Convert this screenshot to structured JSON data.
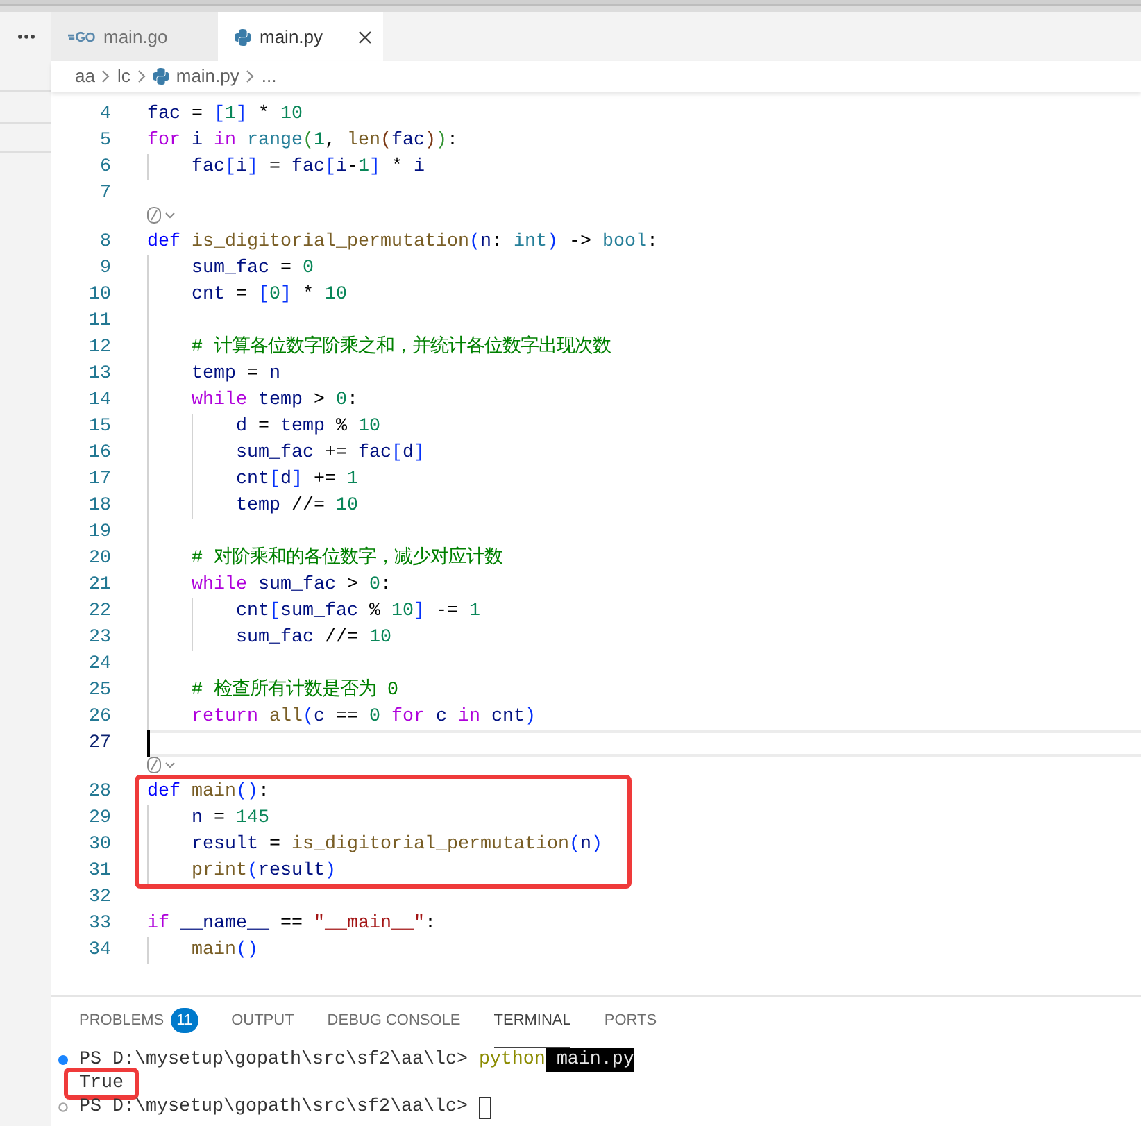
{
  "tabs": [
    {
      "label": "main.go",
      "kind": "go",
      "selected": false
    },
    {
      "label": "main.py",
      "kind": "python",
      "selected": true
    }
  ],
  "breadcrumbs": [
    {
      "label": "aa",
      "kind": "folder"
    },
    {
      "label": "lc",
      "kind": "folder"
    },
    {
      "label": "main.py",
      "kind": "python"
    },
    {
      "label": "...",
      "kind": "symbols"
    }
  ],
  "editor": {
    "lines": [
      {
        "kind": "code",
        "number": "4",
        "current": false,
        "boxed": false,
        "tokens": [
          {
            "text": "fac",
            "kind": "var"
          },
          {
            "text": " = ",
            "kind": "op"
          },
          {
            "text": "[",
            "kind": "b1"
          },
          {
            "text": "1",
            "kind": "num"
          },
          {
            "text": "]",
            "kind": "b1"
          },
          {
            "text": " * ",
            "kind": "op"
          },
          {
            "text": "10",
            "kind": "num"
          }
        ]
      },
      {
        "kind": "code",
        "number": "5",
        "current": false,
        "boxed": false,
        "tokens": [
          {
            "text": "for",
            "kind": "ctl"
          },
          {
            "text": " i",
            "kind": "var"
          },
          {
            "text": " in",
            "kind": "ctl"
          },
          {
            "text": " range",
            "kind": "type"
          },
          {
            "text": "(",
            "kind": "b2"
          },
          {
            "text": "1",
            "kind": "num"
          },
          {
            "text": ", ",
            "kind": "op"
          },
          {
            "text": "len",
            "kind": "fn"
          },
          {
            "text": "(",
            "kind": "b3"
          },
          {
            "text": "fac",
            "kind": "var"
          },
          {
            "text": ")",
            "kind": "b3"
          },
          {
            "text": ")",
            "kind": "b2"
          },
          {
            "text": ":",
            "kind": "op"
          }
        ]
      },
      {
        "kind": "code",
        "number": "6",
        "current": false,
        "boxed": false,
        "tokens": [
          {
            "text": "    fac",
            "kind": "var"
          },
          {
            "text": "[",
            "kind": "b1"
          },
          {
            "text": "i",
            "kind": "var"
          },
          {
            "text": "]",
            "kind": "b1"
          },
          {
            "text": " = ",
            "kind": "op"
          },
          {
            "text": "fac",
            "kind": "var"
          },
          {
            "text": "[",
            "kind": "b1"
          },
          {
            "text": "i",
            "kind": "var"
          },
          {
            "text": "-",
            "kind": "op"
          },
          {
            "text": "1",
            "kind": "num"
          },
          {
            "text": "]",
            "kind": "b1"
          },
          {
            "text": " * ",
            "kind": "op"
          },
          {
            "text": "i",
            "kind": "var"
          }
        ]
      },
      {
        "kind": "code",
        "number": "7",
        "current": false,
        "boxed": false
      },
      {
        "kind": "lens"
      },
      {
        "kind": "code",
        "number": "8",
        "current": false,
        "boxed": false,
        "tokens": [
          {
            "text": "def",
            "kind": "kw"
          },
          {
            "text": " is_digitorial_permutation",
            "kind": "fn"
          },
          {
            "text": "(",
            "kind": "b1"
          },
          {
            "text": "n",
            "kind": "var"
          },
          {
            "text": ": ",
            "kind": "op"
          },
          {
            "text": "int",
            "kind": "type"
          },
          {
            "text": ")",
            "kind": "b1"
          },
          {
            "text": " -> ",
            "kind": "op"
          },
          {
            "text": "bool",
            "kind": "type"
          },
          {
            "text": ":",
            "kind": "op"
          }
        ]
      },
      {
        "kind": "code",
        "number": "9",
        "current": false,
        "boxed": false,
        "tokens": [
          {
            "text": "    sum_fac",
            "kind": "var"
          },
          {
            "text": " = ",
            "kind": "op"
          },
          {
            "text": "0",
            "kind": "num"
          }
        ]
      },
      {
        "kind": "code",
        "number": "10",
        "current": false,
        "boxed": false,
        "tokens": [
          {
            "text": "    cnt",
            "kind": "var"
          },
          {
            "text": " = ",
            "kind": "op"
          },
          {
            "text": "[",
            "kind": "b1"
          },
          {
            "text": "0",
            "kind": "num"
          },
          {
            "text": "]",
            "kind": "b1"
          },
          {
            "text": " * ",
            "kind": "op"
          },
          {
            "text": "10",
            "kind": "num"
          }
        ]
      },
      {
        "kind": "code",
        "number": "11",
        "current": false,
        "boxed": false
      },
      {
        "kind": "code",
        "number": "12",
        "current": false,
        "boxed": false,
        "tokens": [
          {
            "text": "    # 计算各位数字阶乘之和，并统计各位数字出现次数",
            "kind": "com"
          }
        ]
      },
      {
        "kind": "code",
        "number": "13",
        "current": false,
        "boxed": false,
        "tokens": [
          {
            "text": "    temp",
            "kind": "var"
          },
          {
            "text": " = ",
            "kind": "op"
          },
          {
            "text": "n",
            "kind": "var"
          }
        ]
      },
      {
        "kind": "code",
        "number": "14",
        "current": false,
        "boxed": false,
        "tokens": [
          {
            "text": "    while",
            "kind": "ctl"
          },
          {
            "text": " temp",
            "kind": "var"
          },
          {
            "text": " > ",
            "kind": "op"
          },
          {
            "text": "0",
            "kind": "num"
          },
          {
            "text": ":",
            "kind": "op"
          }
        ]
      },
      {
        "kind": "code",
        "number": "15",
        "current": false,
        "boxed": false,
        "tokens": [
          {
            "text": "        d",
            "kind": "var"
          },
          {
            "text": " = ",
            "kind": "op"
          },
          {
            "text": "temp",
            "kind": "var"
          },
          {
            "text": " % ",
            "kind": "op"
          },
          {
            "text": "10",
            "kind": "num"
          }
        ]
      },
      {
        "kind": "code",
        "number": "16",
        "current": false,
        "boxed": false,
        "tokens": [
          {
            "text": "        sum_fac",
            "kind": "var"
          },
          {
            "text": " += ",
            "kind": "op"
          },
          {
            "text": "fac",
            "kind": "var"
          },
          {
            "text": "[",
            "kind": "b1"
          },
          {
            "text": "d",
            "kind": "var"
          },
          {
            "text": "]",
            "kind": "b1"
          }
        ]
      },
      {
        "kind": "code",
        "number": "17",
        "current": false,
        "boxed": false,
        "tokens": [
          {
            "text": "        cnt",
            "kind": "var"
          },
          {
            "text": "[",
            "kind": "b1"
          },
          {
            "text": "d",
            "kind": "var"
          },
          {
            "text": "]",
            "kind": "b1"
          },
          {
            "text": " += ",
            "kind": "op"
          },
          {
            "text": "1",
            "kind": "num"
          }
        ]
      },
      {
        "kind": "code",
        "number": "18",
        "current": false,
        "boxed": false,
        "tokens": [
          {
            "text": "        temp",
            "kind": "var"
          },
          {
            "text": " //= ",
            "kind": "op"
          },
          {
            "text": "10",
            "kind": "num"
          }
        ]
      },
      {
        "kind": "code",
        "number": "19",
        "current": false,
        "boxed": false
      },
      {
        "kind": "code",
        "number": "20",
        "current": false,
        "boxed": false,
        "tokens": [
          {
            "text": "    # 对阶乘和的各位数字，减少对应计数",
            "kind": "com"
          }
        ]
      },
      {
        "kind": "code",
        "number": "21",
        "current": false,
        "boxed": false,
        "tokens": [
          {
            "text": "    while",
            "kind": "ctl"
          },
          {
            "text": " sum_fac",
            "kind": "var"
          },
          {
            "text": " > ",
            "kind": "op"
          },
          {
            "text": "0",
            "kind": "num"
          },
          {
            "text": ":",
            "kind": "op"
          }
        ]
      },
      {
        "kind": "code",
        "number": "22",
        "current": false,
        "boxed": false,
        "tokens": [
          {
            "text": "        cnt",
            "kind": "var"
          },
          {
            "text": "[",
            "kind": "b1"
          },
          {
            "text": "sum_fac",
            "kind": "var"
          },
          {
            "text": " % ",
            "kind": "op"
          },
          {
            "text": "10",
            "kind": "num"
          },
          {
            "text": "]",
            "kind": "b1"
          },
          {
            "text": " -= ",
            "kind": "op"
          },
          {
            "text": "1",
            "kind": "num"
          }
        ]
      },
      {
        "kind": "code",
        "number": "23",
        "current": false,
        "boxed": false,
        "tokens": [
          {
            "text": "        sum_fac",
            "kind": "var"
          },
          {
            "text": " //= ",
            "kind": "op"
          },
          {
            "text": "10",
            "kind": "num"
          }
        ]
      },
      {
        "kind": "code",
        "number": "24",
        "current": false,
        "boxed": false
      },
      {
        "kind": "code",
        "number": "25",
        "current": false,
        "boxed": false,
        "tokens": [
          {
            "text": "    # 检查所有计数是否为 0",
            "kind": "com"
          }
        ]
      },
      {
        "kind": "code",
        "number": "26",
        "current": false,
        "boxed": false,
        "tokens": [
          {
            "text": "    return",
            "kind": "ctl"
          },
          {
            "text": " all",
            "kind": "fn"
          },
          {
            "text": "(",
            "kind": "b1"
          },
          {
            "text": "c",
            "kind": "var"
          },
          {
            "text": " == ",
            "kind": "op"
          },
          {
            "text": "0",
            "kind": "num"
          },
          {
            "text": " for",
            "kind": "ctl"
          },
          {
            "text": " c",
            "kind": "var"
          },
          {
            "text": " in",
            "kind": "ctl"
          },
          {
            "text": " cnt",
            "kind": "var"
          },
          {
            "text": ")",
            "kind": "b1"
          }
        ]
      },
      {
        "kind": "code",
        "number": "27",
        "current": true,
        "boxed": false
      },
      {
        "kind": "lens"
      },
      {
        "kind": "code",
        "number": "28",
        "current": false,
        "boxed": true,
        "tokens": [
          {
            "text": "def",
            "kind": "kw"
          },
          {
            "text": " main",
            "kind": "fn"
          },
          {
            "text": "()",
            "kind": "b1"
          },
          {
            "text": ":",
            "kind": "op"
          }
        ]
      },
      {
        "kind": "code",
        "number": "29",
        "current": false,
        "boxed": true,
        "tokens": [
          {
            "text": "    n",
            "kind": "var"
          },
          {
            "text": " = ",
            "kind": "op"
          },
          {
            "text": "145",
            "kind": "num"
          }
        ]
      },
      {
        "kind": "code",
        "number": "30",
        "current": false,
        "boxed": true,
        "tokens": [
          {
            "text": "    result",
            "kind": "var"
          },
          {
            "text": " = ",
            "kind": "op"
          },
          {
            "text": "is_digitorial_permutation",
            "kind": "fn"
          },
          {
            "text": "(",
            "kind": "b1"
          },
          {
            "text": "n",
            "kind": "var"
          },
          {
            "text": ")",
            "kind": "b1"
          }
        ]
      },
      {
        "kind": "code",
        "number": "31",
        "current": false,
        "boxed": true,
        "tokens": [
          {
            "text": "    print",
            "kind": "fn"
          },
          {
            "text": "(",
            "kind": "b1"
          },
          {
            "text": "result",
            "kind": "var"
          },
          {
            "text": ")",
            "kind": "b1"
          }
        ]
      },
      {
        "kind": "code",
        "number": "32",
        "current": false,
        "boxed": false
      },
      {
        "kind": "code",
        "number": "33",
        "current": false,
        "boxed": false,
        "tokens": [
          {
            "text": "if",
            "kind": "ctl"
          },
          {
            "text": " __name__",
            "kind": "var"
          },
          {
            "text": " == ",
            "kind": "op"
          },
          {
            "text": "\"__main__\"",
            "kind": "str"
          },
          {
            "text": ":",
            "kind": "op"
          }
        ]
      },
      {
        "kind": "code",
        "number": "34",
        "current": false,
        "boxed": false,
        "tokens": [
          {
            "text": "    main",
            "kind": "fn"
          },
          {
            "text": "()",
            "kind": "b1"
          }
        ]
      }
    ]
  },
  "panel": {
    "tabs": [
      {
        "label": "PROBLEMS",
        "badge": "11",
        "selected": false
      },
      {
        "label": "OUTPUT",
        "selected": false
      },
      {
        "label": "DEBUG CONSOLE",
        "selected": false
      },
      {
        "label": "TERMINAL",
        "selected": true
      },
      {
        "label": "PORTS",
        "selected": false
      }
    ],
    "terminal": {
      "lines": [
        {
          "kind": "command",
          "boxed": false,
          "segments": [
            {
              "text": "PS D:\\mysetup\\gopath\\src\\sf2\\aa\\lc>",
              "kind": "prompt"
            },
            {
              "text": "python",
              "kind": "command"
            },
            {
              "text": "main.py",
              "kind": "selection"
            }
          ]
        },
        {
          "kind": "output",
          "boxed": true,
          "segments": [
            {
              "text": "True",
              "kind": "output"
            }
          ]
        },
        {
          "kind": "prompt",
          "boxed": false,
          "segments": [
            {
              "text": "PS D:\\mysetup\\gopath\\src\\sf2\\aa\\lc>",
              "kind": "prompt"
            }
          ]
        }
      ]
    }
  }
}
